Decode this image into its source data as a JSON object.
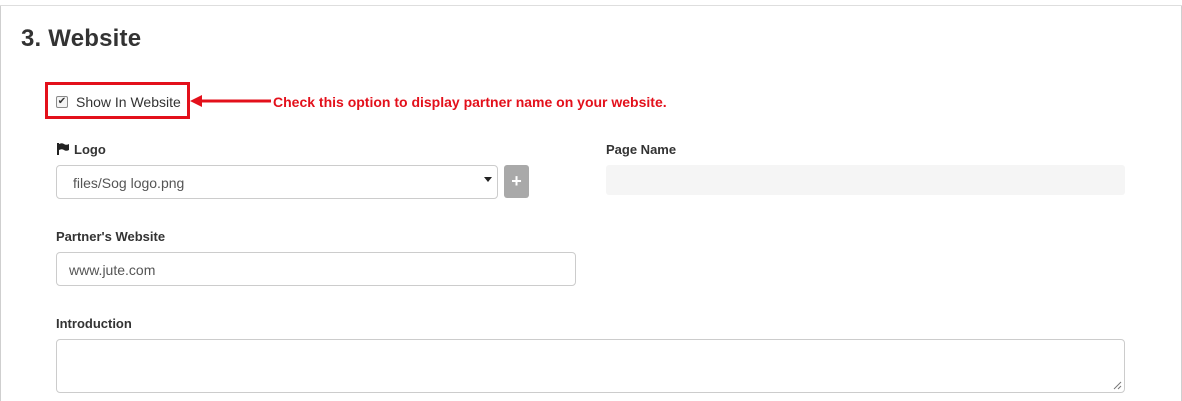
{
  "section": {
    "title": "3. Website"
  },
  "show_in_website": {
    "label": "Show In Website",
    "checked": true
  },
  "annotation": {
    "text": "Check this option to display partner name on your website.",
    "color": "#e3101b"
  },
  "logo": {
    "label": "Logo",
    "selected_value": "files/Sog logo.png",
    "add_button_icon": "plus-icon"
  },
  "page_name": {
    "label": "Page Name",
    "value": ""
  },
  "partners_website": {
    "label": "Partner's Website",
    "value": "www.jute.com"
  },
  "introduction": {
    "label": "Introduction",
    "value": ""
  },
  "colors": {
    "highlight": "#e3101b",
    "add_button": "#a9a9a9",
    "disabled_input": "#f5f5f5"
  }
}
